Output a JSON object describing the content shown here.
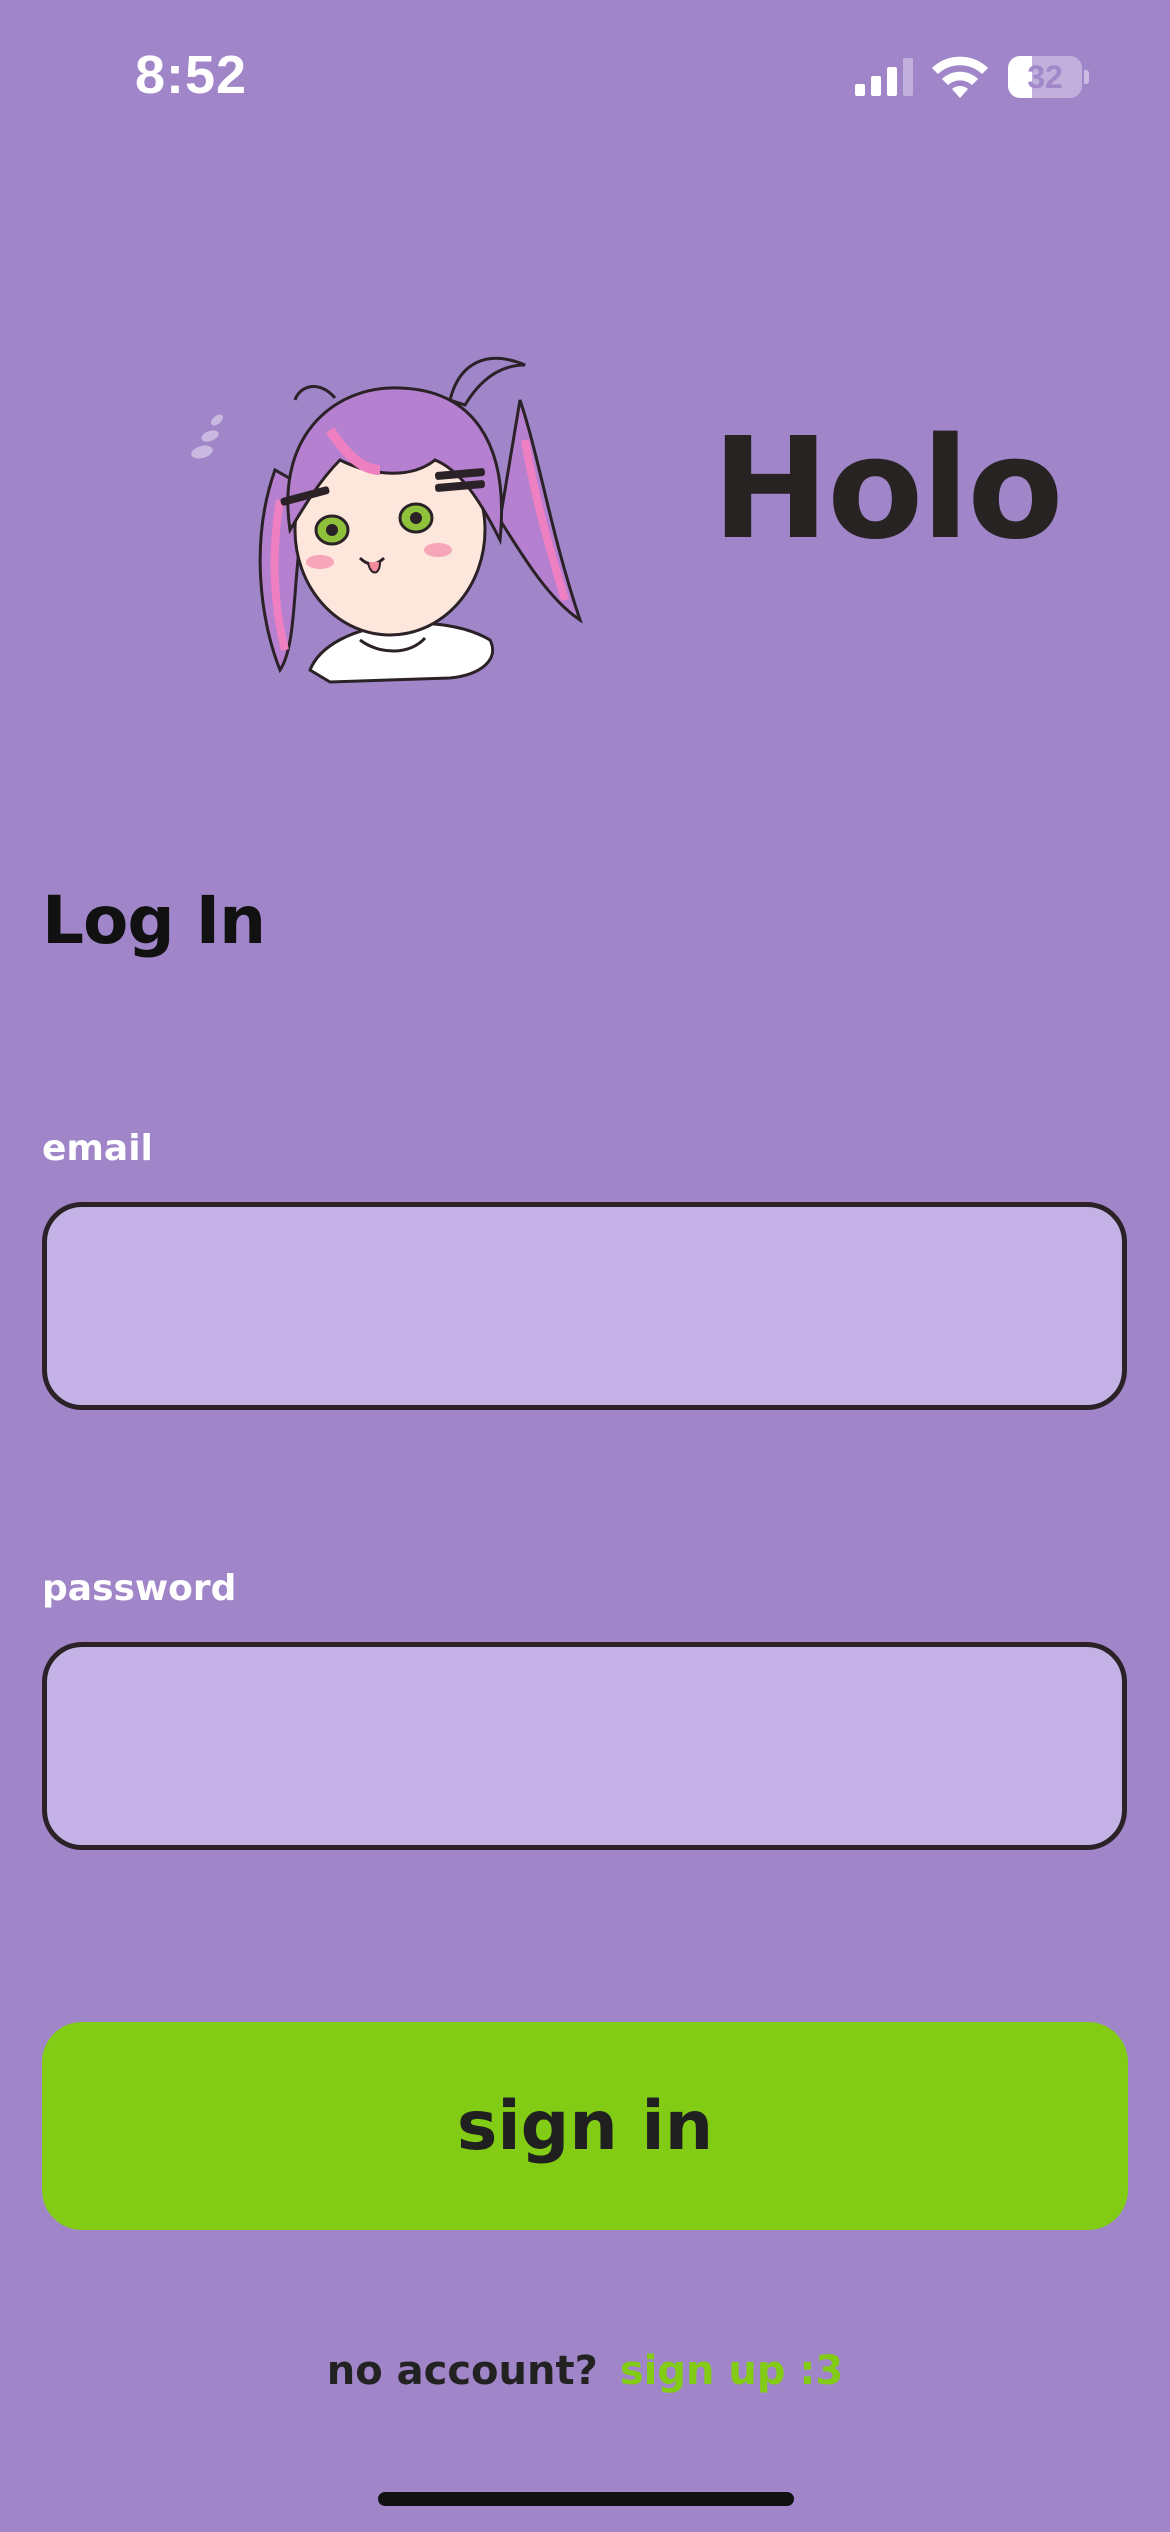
{
  "status_bar": {
    "time": "8:52",
    "battery_percent": "32",
    "battery_level": 0.32,
    "signal_bars": 3,
    "icons": [
      "cellular-signal-icon",
      "wifi-icon",
      "battery-icon"
    ]
  },
  "header": {
    "app_name": "Holo",
    "mascot": "anime-girl-mascot"
  },
  "login": {
    "title": "Log In",
    "email_label": "email",
    "email_value": "",
    "password_label": "password",
    "password_value": "",
    "submit_label": "sign in"
  },
  "footer": {
    "prompt": "no account?",
    "link": "sign up :3"
  },
  "colors": {
    "background": "#a085c9",
    "input_fill": "#c4b2e6",
    "accent": "#82cc16",
    "text_dark": "#272323"
  }
}
